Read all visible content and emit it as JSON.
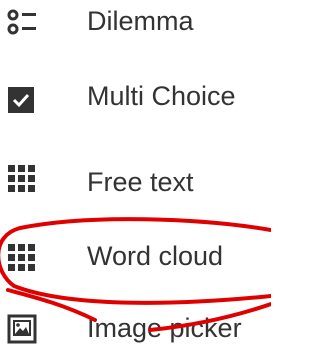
{
  "menu": {
    "items": [
      {
        "label": "Dilemma",
        "icon": "dilemma-list-icon"
      },
      {
        "label": "Multi Choice",
        "icon": "checkbox-checked-icon"
      },
      {
        "label": "Free text",
        "icon": "grid-dots-icon"
      },
      {
        "label": "Word cloud",
        "icon": "grid-dots-icon"
      },
      {
        "label": "Image picker",
        "icon": "image-icon"
      }
    ]
  },
  "colors": {
    "icon": "#333333",
    "text": "#333333",
    "annotation": "#e00000"
  }
}
